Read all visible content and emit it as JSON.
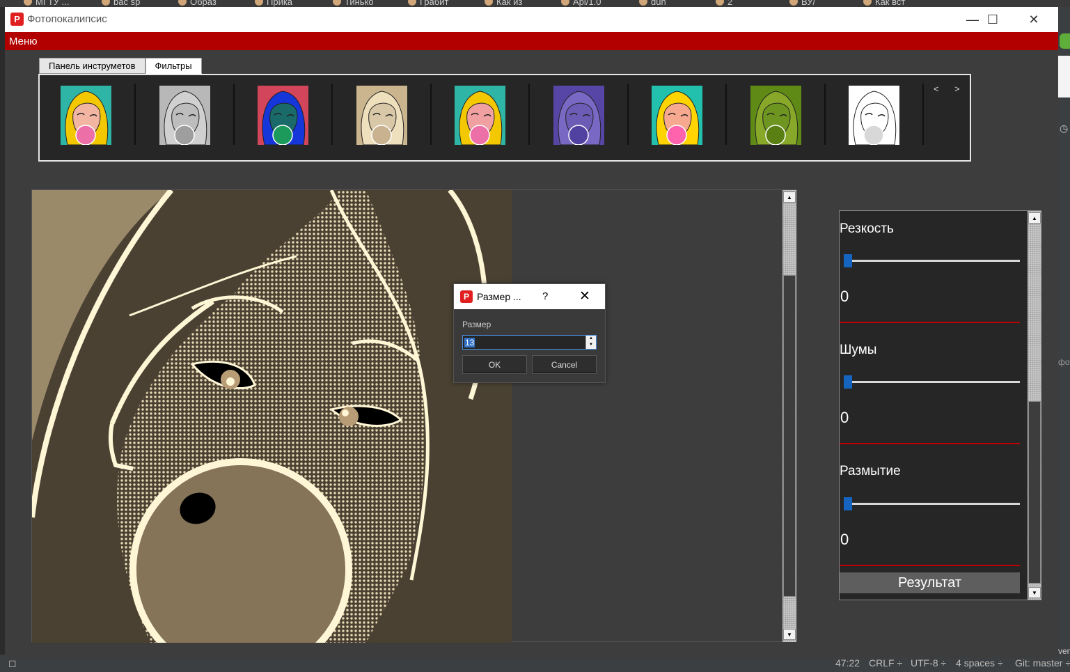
{
  "browser_tabs": [
    "МГТУ ...",
    "bac sp",
    "Образ",
    "Прика",
    "Тинько",
    "Грабит",
    "Как из",
    "Api/1.0",
    "dun",
    "2",
    "ВУ/",
    "Как вст"
  ],
  "ide_status": {
    "position": "47:22",
    "line_ending": "CRLF ÷",
    "encoding": "UTF-8 ÷",
    "indent": "4 spaces ÷",
    "vcs": "Git: master ÷",
    "side_text": "ven",
    "side_text2": "фот"
  },
  "window": {
    "title": "Фотопокалипсис",
    "icon_letter": "P",
    "minimize_glyph": "—",
    "maximize_glyph": "☐",
    "close_glyph": "✕"
  },
  "menu": {
    "label": "Меню"
  },
  "tabs": [
    {
      "label": "Панель инструметов",
      "active": false
    },
    {
      "label": "Фильтры",
      "active": true
    }
  ],
  "filters": {
    "prev": "<",
    "next": ">",
    "thumbnails": [
      {
        "name": "original",
        "bg": "#2fb5a6",
        "hair": "#f4c800",
        "face": "#f2b5a2",
        "bubble": "#ec6fa8"
      },
      {
        "name": "grayscale",
        "bg": "#b8b8b8",
        "hair": "#d0d0d0",
        "face": "#bdbdbd",
        "bubble": "#9e9e9e"
      },
      {
        "name": "inverted",
        "bg": "#d2455a",
        "hair": "#1536d8",
        "face": "#1b6a6a",
        "bubble": "#1b9a5c"
      },
      {
        "name": "sepia",
        "bg": "#cbb58f",
        "hair": "#efe0bd",
        "face": "#d9c8a7",
        "bubble": "#c9b290"
      },
      {
        "name": "pop-art-dots",
        "bg": "#2fb5a6",
        "hair": "#f4c800",
        "face": "#f0a0a0",
        "bubble": "#ec6fa8"
      },
      {
        "name": "purple-tone",
        "bg": "#5846a6",
        "hair": "#7a69c4",
        "face": "#6c5cb6",
        "bubble": "#5141a0"
      },
      {
        "name": "saturated",
        "bg": "#22c1ae",
        "hair": "#ffd400",
        "face": "#f7a98f",
        "bubble": "#ff63ad"
      },
      {
        "name": "green-tone",
        "bg": "#5f8a16",
        "hair": "#87a829",
        "face": "#6e9520",
        "bubble": "#5a8014"
      },
      {
        "name": "black-white",
        "bg": "#ffffff",
        "hair": "#ffffff",
        "face": "#ffffff",
        "bubble": "#d8d8d8"
      }
    ]
  },
  "image": {
    "bg_color": "#9b8a6a",
    "hair_color": "#4a4132",
    "line_color": "#fff6d6",
    "bubble_color": "#857457"
  },
  "dialog": {
    "title": "Размер ...",
    "help": "?",
    "close": "✕",
    "field_label": "Размер",
    "value": "13",
    "ok": "OK",
    "cancel": "Cancel"
  },
  "adjustments": {
    "items": [
      {
        "label": "Резкость",
        "value": "0"
      },
      {
        "label": "Шумы",
        "value": "0"
      },
      {
        "label": "Размытие",
        "value": "0"
      }
    ],
    "result_button": "Результат"
  },
  "colors": {
    "accent_red": "#b20000",
    "slider_handle": "#1565c0"
  }
}
